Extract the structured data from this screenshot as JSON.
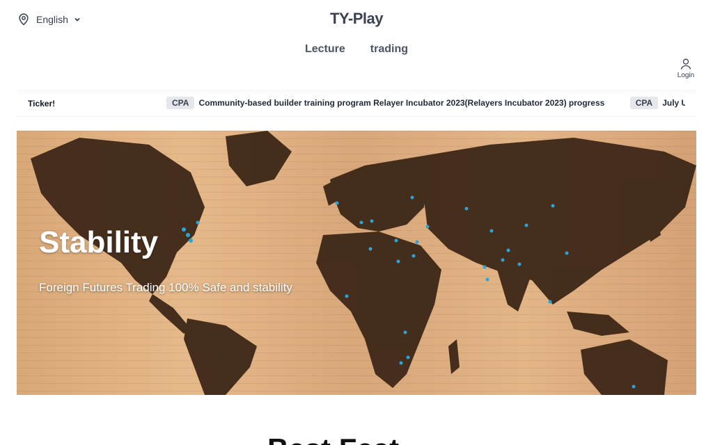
{
  "header": {
    "language": "English",
    "brand": "TY-Play",
    "nav": [
      "Lecture",
      "trading"
    ],
    "login_label": "Login"
  },
  "ticker": {
    "label": "Ticker!",
    "items": [
      {
        "badge": "CPA",
        "text": "Community-based builder training program Relayer Incubator 2023(Relayers Incubator 2023) progress"
      },
      {
        "badge": "CPA",
        "text": "July U"
      }
    ]
  },
  "hero": {
    "title": "Stability",
    "subtitle": "Foreign Futures Trading 100% Safe and stability",
    "pin_color": "#2aa6d6",
    "map_color": "#3a2415"
  },
  "section": {
    "heading": "Best Feat"
  }
}
